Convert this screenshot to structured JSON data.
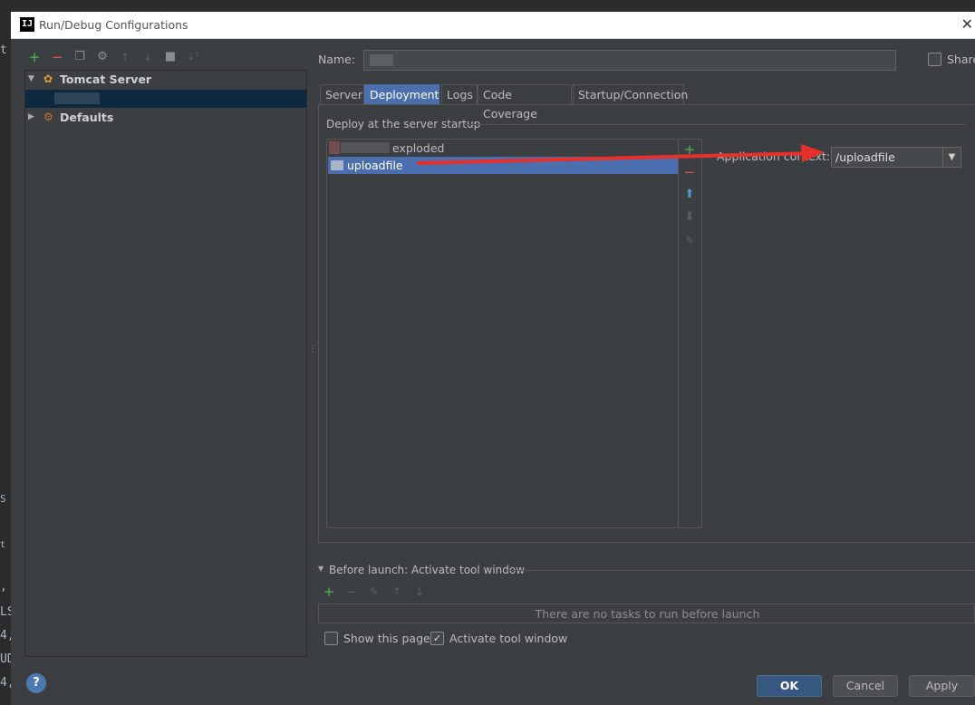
{
  "window": {
    "title": "Run/Debug Configurations",
    "app_icon": "IJ"
  },
  "editor_background": {
    "fragments": [
      "t",
      ",",
      "LS",
      "4,",
      "UD",
      "4,",
      "S",
      "t Ca"
    ]
  },
  "left_toolbar": {
    "icons": [
      "add-icon",
      "remove-icon",
      "copy-icon",
      "wrench-icon",
      "move-up-icon",
      "move-down-icon",
      "folder-icon",
      "sort-icon"
    ]
  },
  "tree": {
    "items": [
      {
        "label": "Tomcat Server",
        "expanded": true
      },
      {
        "label": "Defaults",
        "expanded": false
      }
    ]
  },
  "name_field": {
    "label": "Name:",
    "value": ""
  },
  "share": {
    "label": "Share",
    "checked": false
  },
  "tabs": [
    {
      "label": "Server",
      "active": false
    },
    {
      "label": "Deployment",
      "active": true
    },
    {
      "label": "Logs",
      "active": false
    },
    {
      "label": "Code Coverage",
      "active": false
    },
    {
      "label": "Startup/Connection",
      "active": false
    }
  ],
  "deployment": {
    "section_title": "Deploy at the server startup",
    "artifacts": [
      {
        "label": "exploded",
        "selected": false
      },
      {
        "label": "uploadfile",
        "selected": true
      }
    ],
    "context_label": "Application context:",
    "context_value": "/uploadfile"
  },
  "before_launch": {
    "title": "Before launch: Activate tool window",
    "empty_message": "There are no tasks to run before launch"
  },
  "options": {
    "show_this_page": {
      "label": "Show this page",
      "checked": false
    },
    "activate_tool_window": {
      "label": "Activate tool window",
      "checked": true
    }
  },
  "buttons": {
    "ok": "OK",
    "cancel": "Cancel",
    "apply": "Apply",
    "help": "?"
  },
  "colors": {
    "accent": "#4b6eaf",
    "annotation_arrow": "#e8302a"
  }
}
